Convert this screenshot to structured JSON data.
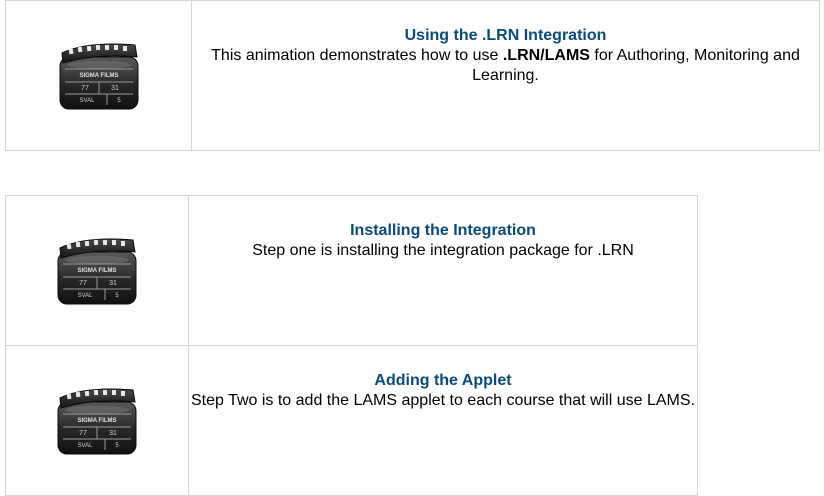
{
  "videos_top": [
    {
      "icon": "clapperboard-icon",
      "title": "Using the .LRN Integration",
      "desc_before": "This animation demonstrates how to use ",
      "desc_bold": ".LRN/LAMS",
      "desc_after": " for Authoring, Monitoring and Learning."
    }
  ],
  "videos_steps": [
    {
      "icon": "clapperboard-icon",
      "title": "Installing the Integration",
      "desc": "Step one is installing the integration package for .LRN"
    },
    {
      "icon": "clapperboard-icon",
      "title": "Adding the Applet",
      "desc": "Step Two is to add the LAMS applet to each course that will use LAMS."
    }
  ],
  "icon_label": {
    "brand": "SIGMA FILMS",
    "left_number": "77",
    "right_number": "31",
    "bottom_left": "SVAL",
    "bottom_right": "5"
  }
}
